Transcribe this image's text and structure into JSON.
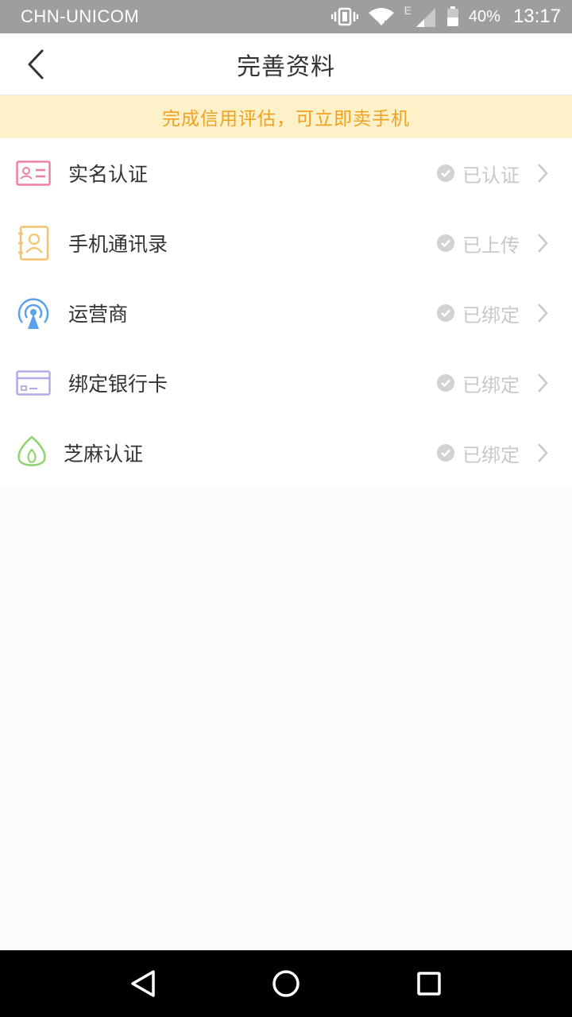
{
  "status_bar": {
    "carrier": "CHN-UNICOM",
    "network_type": "E",
    "battery_percent": "40%",
    "time": "13:17"
  },
  "header": {
    "title": "完善资料"
  },
  "notice": {
    "text": "完成信用评估，可立即卖手机"
  },
  "items": [
    {
      "label": "实名认证",
      "status": "已认证",
      "icon": "id-card-icon",
      "color": "#f27fa0"
    },
    {
      "label": "手机通讯录",
      "status": "已上传",
      "icon": "contacts-book-icon",
      "color": "#f3c36b"
    },
    {
      "label": "运营商",
      "status": "已绑定",
      "icon": "signal-tower-icon",
      "color": "#5aa0ea"
    },
    {
      "label": "绑定银行卡",
      "status": "已绑定",
      "icon": "bank-card-icon",
      "color": "#b6a9e6"
    },
    {
      "label": "芝麻认证",
      "status": "已绑定",
      "icon": "sesame-seed-icon",
      "color": "#8fd36f"
    }
  ],
  "colors": {
    "status_bar_bg": "#9e9e9e",
    "notice_bg": "#fdf1c9",
    "notice_text": "#f0a11e",
    "status_text": "#c8c8c8"
  }
}
